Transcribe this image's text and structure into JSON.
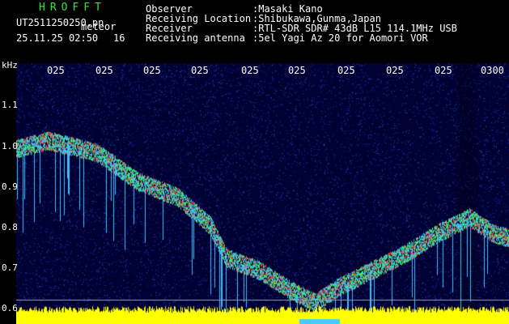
{
  "app": {
    "title": "HROFFT",
    "filename": "UT2511250250.pn",
    "mode": "meteor",
    "timestamp": "25.11.25 02:50",
    "count": "16"
  },
  "info": [
    {
      "label": "Observer",
      "value": ":Masaki Kano"
    },
    {
      "label": "Receiving Location",
      "value": ":Shibukawa,Gunma,Japan"
    },
    {
      "label": "Receiver",
      "value": ":RTL-SDR SDR# 43dB L15 114.1MHz USB"
    },
    {
      "label": "Receiving antenna",
      "value": ":5el Yagi Az 20 for Aomori VOR"
    }
  ],
  "axis": {
    "unit": "kHz",
    "y_labels": [
      "1.1",
      "1.0",
      "0.9",
      "0.8",
      "0.7",
      "0.6"
    ],
    "x_labels": [
      "025",
      "025",
      "025",
      "025",
      "025",
      "025",
      "025",
      "025",
      "025",
      "0300"
    ]
  },
  "colors": {
    "background": "#000033",
    "noise": "#1a2fa8",
    "signal_hi": "#ff3030",
    "signal_mid": "#30ff60",
    "baseline": "#ffff00"
  }
}
